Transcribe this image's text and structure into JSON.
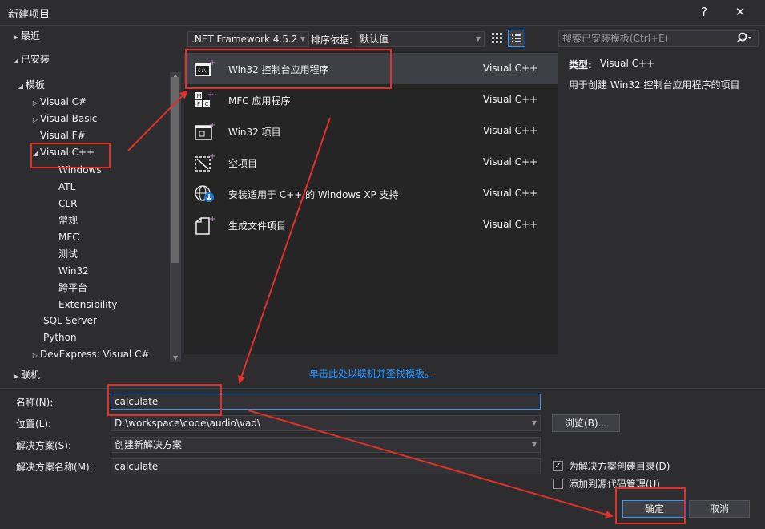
{
  "window": {
    "title": "新建项目",
    "help_glyph": "?",
    "close_glyph": "✕"
  },
  "tree": {
    "recent": "最近",
    "installed": "已安装",
    "templates": "模板",
    "items": [
      "Visual C#",
      "Visual Basic",
      "Visual F#",
      "Visual C++"
    ],
    "cpp_children": [
      "Windows",
      "ATL",
      "CLR",
      "常规",
      "MFC",
      "测试",
      "Win32",
      "跨平台",
      "Extensibility"
    ],
    "more_items": [
      "SQL Server",
      "Python",
      "DevExpress: Visual C#"
    ],
    "online": "联机"
  },
  "toolbar": {
    "framework": ".NET Framework 4.5.2",
    "sort_label": "排序依据:",
    "sort_value": "默认值",
    "search_placeholder": "搜索已安装模板(Ctrl+E)"
  },
  "templates": [
    {
      "name": "Win32 控制台应用程序",
      "lang": "Visual C++"
    },
    {
      "name": "MFC 应用程序",
      "lang": "Visual C++"
    },
    {
      "name": "Win32 项目",
      "lang": "Visual C++"
    },
    {
      "name": "空项目",
      "lang": "Visual C++"
    },
    {
      "name": "安装适用于 C++ 的 Windows XP 支持",
      "lang": "Visual C++"
    },
    {
      "name": "生成文件项目",
      "lang": "Visual C++"
    }
  ],
  "details": {
    "type_label": "类型:",
    "type_value": "Visual C++",
    "description": "用于创建 Win32 控制台应用程序的项目"
  },
  "online_link": "单击此处以联机并查找模板。",
  "form": {
    "name_label": "名称(N):",
    "name_value": "calculate",
    "location_label": "位置(L):",
    "location_value": "D:\\workspace\\code\\audio\\vad\\",
    "solution_label": "解决方案(S):",
    "solution_value": "创建新解决方案",
    "solution_name_label": "解决方案名称(M):",
    "solution_name_value": "calculate",
    "browse": "浏览(B)...",
    "create_dir": "为解决方案创建目录(D)",
    "add_source": "添加到源代码管理(U)",
    "ok": "确定",
    "cancel": "取消"
  },
  "colors": {
    "accent": "#3399ff",
    "annotation": "#e0302a",
    "background": "#2d2d30",
    "panel": "#252526"
  }
}
